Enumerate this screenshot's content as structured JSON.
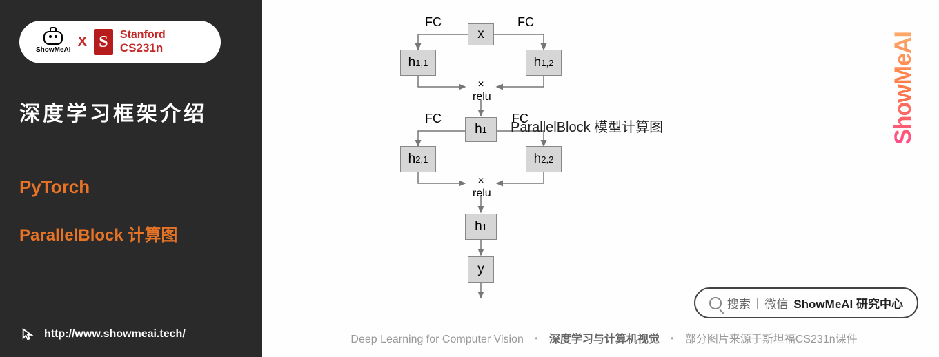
{
  "sidebar": {
    "brand": {
      "showme": "ShowMeAI",
      "x": "X",
      "stanford_top": "Stanford",
      "stanford_bottom": "CS231n"
    },
    "title": "深度学习框架介绍",
    "sub1": "PyTorch",
    "sub2": "ParallelBlock 计算图",
    "url": "http://www.showmeai.tech/"
  },
  "diagram": {
    "nodes": {
      "x": "x",
      "h11": "h",
      "h11s": "1,1",
      "h12": "h",
      "h12s": "1,2",
      "h1": "h",
      "h1s": "1",
      "h21": "h",
      "h21s": "2,1",
      "h22": "h",
      "h22s": "2,2",
      "h1b": "h",
      "h1bs": "1",
      "y": "y"
    },
    "labels": {
      "fc1": "FC",
      "fc2": "FC",
      "fc3": "FC",
      "fc4": "FC",
      "relu1": "relu",
      "relu2": "relu",
      "x1": "×",
      "x2": "×"
    },
    "caption": "ParallelBlock  模型计算图"
  },
  "watermark": "ShowMeAI",
  "search": {
    "prompt": "搜索",
    "sep": "|",
    "platform": "微信",
    "handle": "ShowMeAI 研究中心"
  },
  "footer": {
    "en": "Deep Learning for Computer Vision",
    "sep": "・",
    "zh": "深度学习与计算机视觉",
    "credit": "部分图片来源于斯坦福CS231n课件"
  }
}
